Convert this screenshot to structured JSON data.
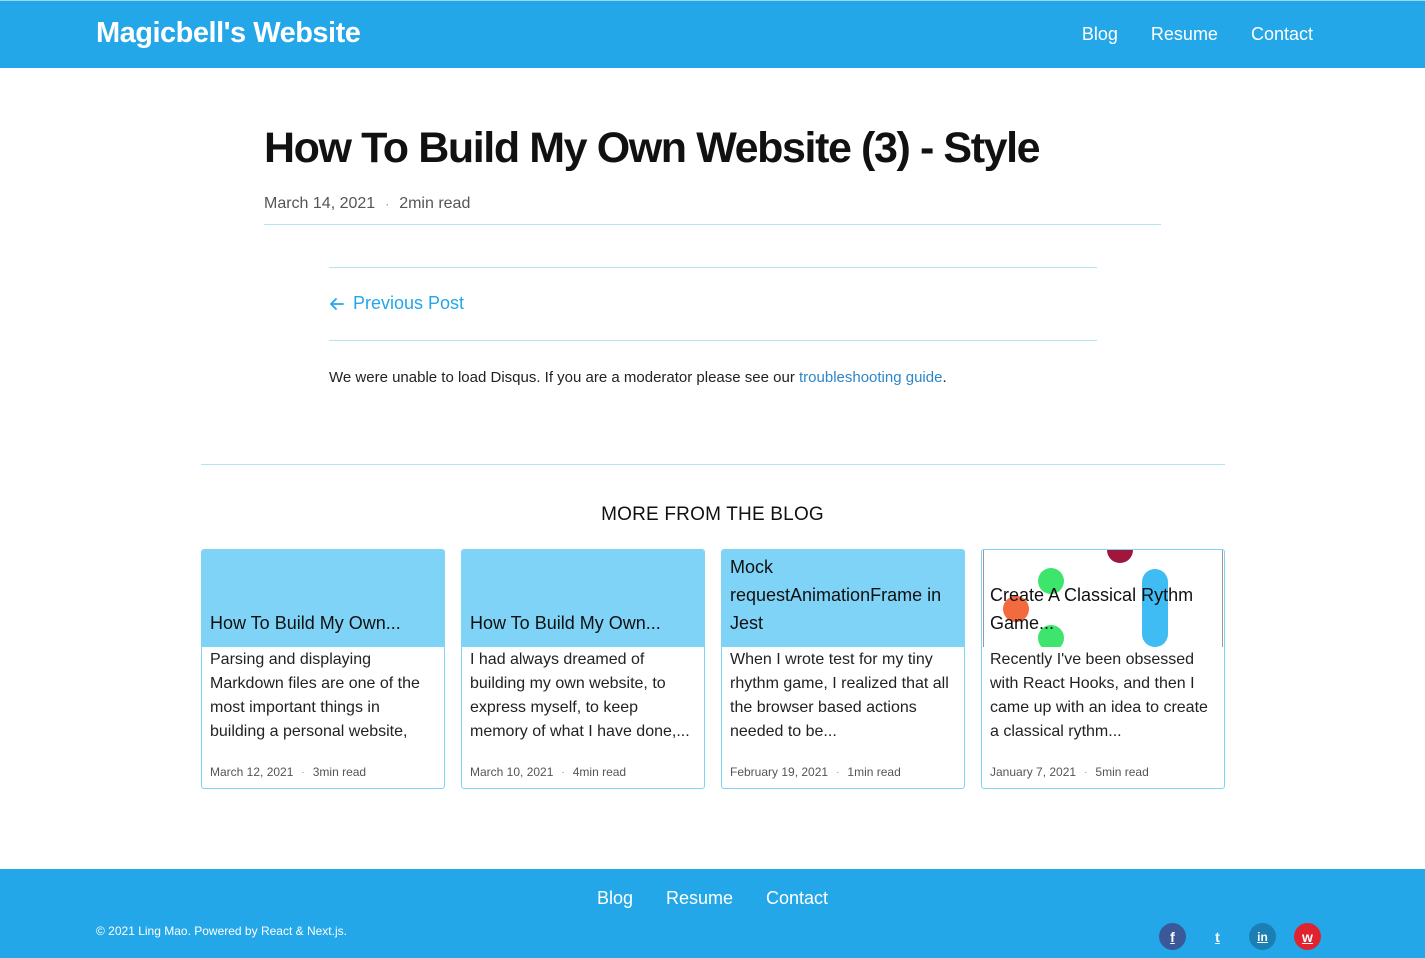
{
  "header": {
    "brand": "Magicbell's Website",
    "nav": [
      "Blog",
      "Resume",
      "Contact"
    ]
  },
  "post": {
    "title": "How To Build My Own Website (3) - Style",
    "date": "March 14, 2021",
    "read_time": "2min read",
    "prev_label": "Previous Post"
  },
  "disqus": {
    "text_before": "We were unable to load Disqus. If you are a moderator please see our ",
    "link": "troubleshooting guide",
    "text_after": "."
  },
  "more": {
    "title": "MORE FROM THE BLOG",
    "cards": [
      {
        "title": "How To Build My Own...",
        "excerpt": "Parsing and displaying Markdown files are one of the most important things in building a personal website,",
        "date": "March 12, 2021",
        "read_time": "3min read"
      },
      {
        "title": "How To Build My Own...",
        "excerpt": "I had always dreamed of building my own website, to express myself, to keep memory of what I have done,...",
        "date": "March 10, 2021",
        "read_time": "4min read"
      },
      {
        "title": "Mock requestAnimationFrame in Jest",
        "excerpt": "When I wrote test for my tiny rhythm game, I realized that all the browser based actions needed to be...",
        "date": "February 19, 2021",
        "read_time": "1min read"
      },
      {
        "title": "Create A Classical Rythm Game...",
        "excerpt": "Recently I've been obsessed with React Hooks, and then I came up with an idea to create a classical rythm...",
        "date": "January 7, 2021",
        "read_time": "5min read"
      }
    ]
  },
  "footer": {
    "nav": [
      "Blog",
      "Resume",
      "Contact"
    ],
    "copyright": "© 2021 Ling Mao. Powered by React & Next.js.",
    "socials": [
      {
        "icon": "facebook-icon",
        "glyph": "f",
        "color": "#3b5998"
      },
      {
        "icon": "twitter-icon",
        "glyph": "t",
        "color": "#23a7e8"
      },
      {
        "icon": "linkedin-icon",
        "glyph": "in",
        "color": "#1b7fb4"
      },
      {
        "icon": "weibo-icon",
        "glyph": "w",
        "color": "#e0242f"
      }
    ]
  }
}
